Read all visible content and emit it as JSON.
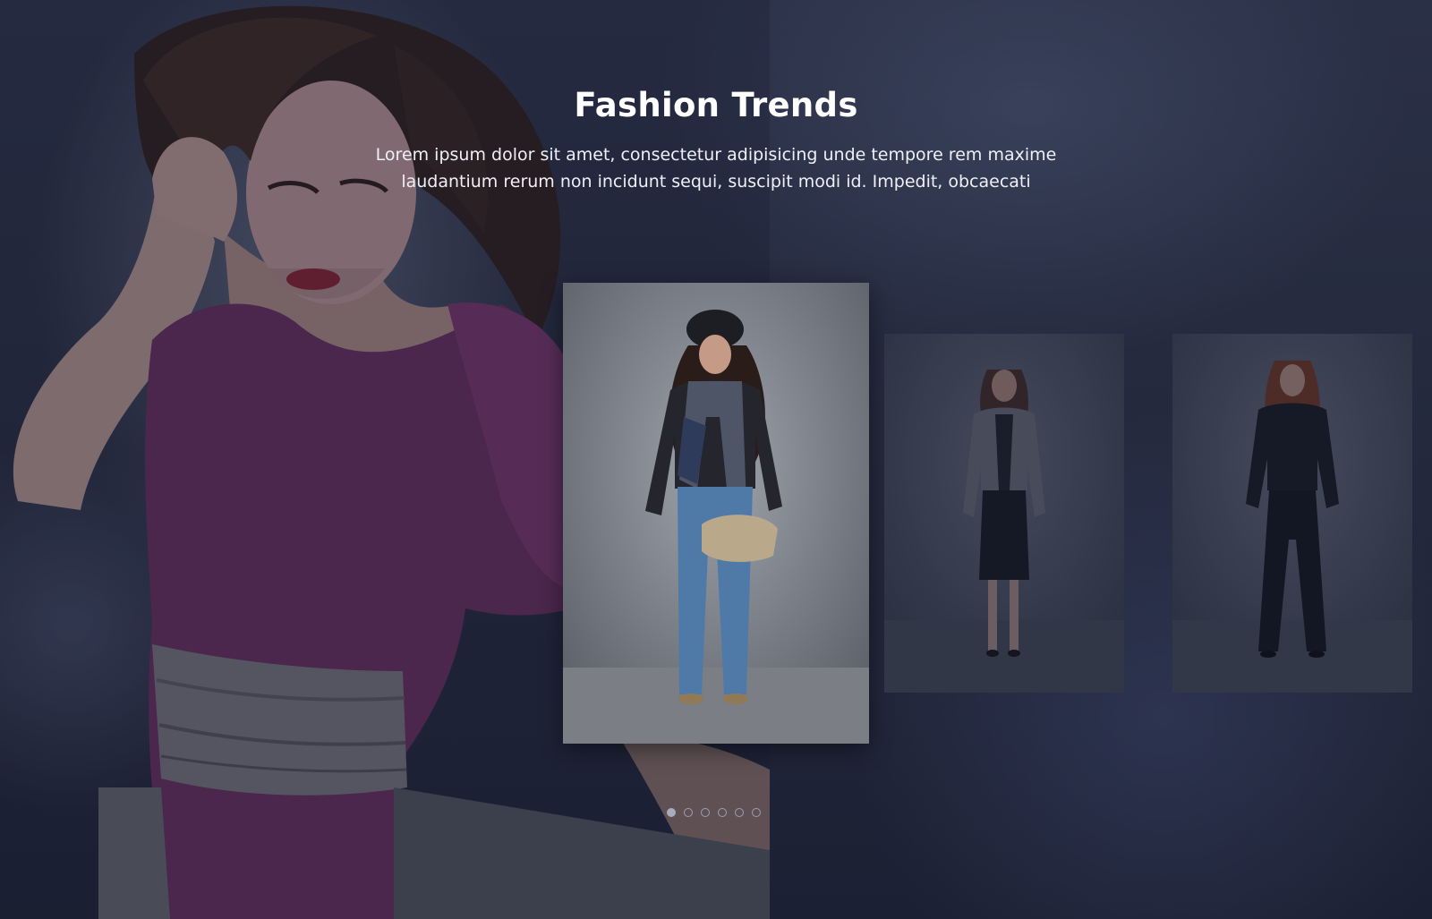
{
  "section": {
    "title": "Fashion Trends",
    "description": "Lorem ipsum dolor sit amet, consectetur adipisicing unde tempore rem maxime laudantium rerum non incidunt sequi, suscipit modi id. Impedit, obcaecati"
  },
  "carousel": {
    "slides": [
      {
        "alt": "model in beret, scarf and jeans"
      },
      {
        "alt": "model in grey blazer and black skirt"
      },
      {
        "alt": "model in black jacket and trousers"
      }
    ],
    "pagination": {
      "total": 6,
      "active": 1
    }
  },
  "colors": {
    "background": "#1f2438",
    "dress": "#6b2a5e",
    "title": "#ffffff",
    "dot_active": "#a8acbc"
  }
}
